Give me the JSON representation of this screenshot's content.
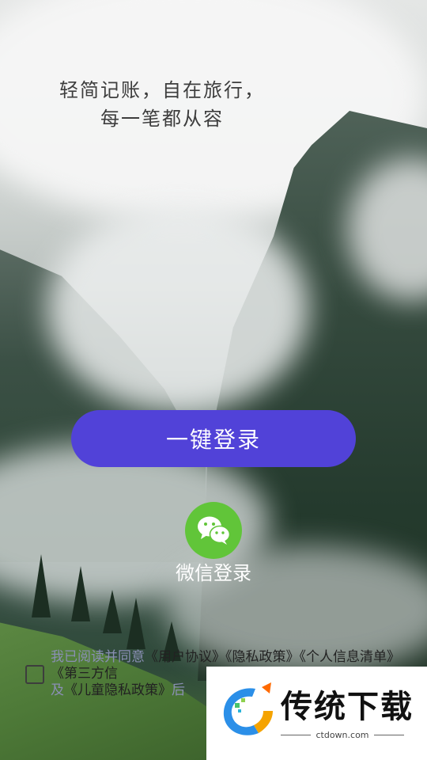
{
  "tagline": {
    "line1": "轻简记账，自在旅行，",
    "line2": "每一笔都从容"
  },
  "login": {
    "one_key_label": "一键登录",
    "wechat_label": "微信登录"
  },
  "agreement": {
    "prefix": "我已阅读并同意",
    "user_agreement": "《用户协议》",
    "privacy_policy": "《隐私政策》",
    "personal_info_list": "《个人信息清单》",
    "third_party_list": "《第三方信",
    "and": "及",
    "children_privacy": "《儿童隐私政策》",
    "suffix": "后"
  },
  "watermark": {
    "brand": "传统下载",
    "url": "ctdown.com"
  },
  "colors": {
    "primary_button": "#5142d8",
    "wechat_green": "#61c539"
  },
  "icons": {
    "wechat": "wechat-icon",
    "checkbox": "checkbox-icon"
  }
}
